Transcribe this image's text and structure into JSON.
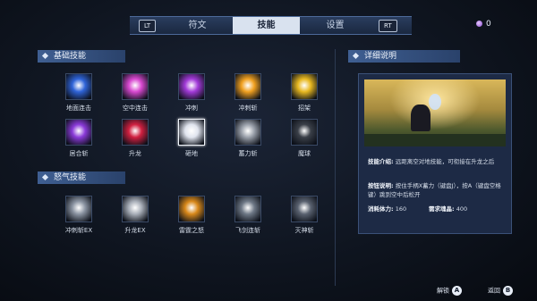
{
  "tabs": {
    "lt": "LT",
    "rt": "RT",
    "items": [
      "符文",
      "技能",
      "设置"
    ],
    "active": "技能"
  },
  "currency": {
    "amount": "0"
  },
  "sections": {
    "basic": "基础技能",
    "rage": "怒气技能",
    "detail": "详细说明"
  },
  "basic_skills": [
    {
      "label": "地面连击",
      "icon": "ground-combo-icon",
      "color": "#2f64d8"
    },
    {
      "label": "空中连击",
      "icon": "air-combo-icon",
      "color": "#d848d0"
    },
    {
      "label": "冲刺",
      "icon": "dash-icon",
      "color": "#a23ad8"
    },
    {
      "label": "冲刺斩",
      "icon": "dash-slash-icon",
      "color": "#f0a020"
    },
    {
      "label": "招架",
      "icon": "parry-icon",
      "color": "#e8b820"
    },
    {
      "label": "居合斩",
      "icon": "iai-slash-icon",
      "color": "#8a3ad8"
    },
    {
      "label": "升龙",
      "icon": "rising-dragon-icon",
      "color": "#d02040"
    },
    {
      "label": "砸地",
      "icon": "ground-smash-icon",
      "color": "#e0e4ee"
    },
    {
      "label": "蓄力斩",
      "icon": "charge-slash-icon",
      "color": "#9aa0aa"
    },
    {
      "label": "魔球",
      "icon": "magic-orb-icon",
      "color": "#3a3f48"
    }
  ],
  "rage_skills": [
    {
      "label": "冲刺斩EX",
      "icon": "dash-slash-ex-icon",
      "color": "#8b94a2"
    },
    {
      "label": "升龙EX",
      "icon": "rising-dragon-ex-icon",
      "color": "#a8aeb8"
    },
    {
      "label": "雷霆之怒",
      "icon": "thunder-wrath-icon",
      "color": "#d8881a"
    },
    {
      "label": "飞剑连斩",
      "icon": "flying-sword-icon",
      "color": "#6e7886"
    },
    {
      "label": "灭神斩",
      "icon": "god-slayer-icon",
      "color": "#5a6270"
    }
  ],
  "selected_skill": "砸地",
  "detail": {
    "intro_label": "技能介绍:",
    "intro_text": "远距离空对地技能，可衔接在升龙之后",
    "control_label": "按钮说明:",
    "control_text": "按住手柄X蓄力（键盘J），按A（键盘空格键）跳到空中后松开",
    "stamina_label": "消耗体力:",
    "stamina_value": "160",
    "soul_label": "需求魂晶:",
    "soul_value": "400"
  },
  "bottom": {
    "unlock": "解锁",
    "unlock_key": "A",
    "back": "返回",
    "back_key": "B"
  }
}
